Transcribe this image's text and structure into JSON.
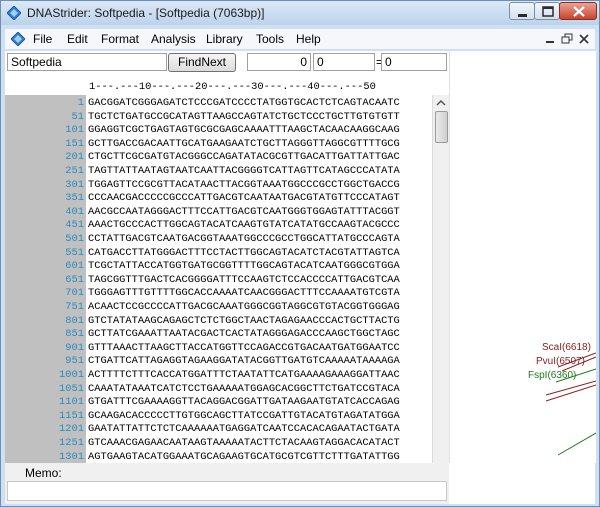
{
  "window": {
    "title": "DNAStrider: Softpedia - [Softpedia (7063bp)]"
  },
  "menu": [
    "File",
    "Edit",
    "Format",
    "Analysis",
    "Library",
    "Tools",
    "Help"
  ],
  "toolbar": {
    "search_value": "Softpedia",
    "findnext_label": "FindNext",
    "range_start": "0",
    "range_sep": "-",
    "range_end": "0",
    "equals": "=",
    "range_result": "0"
  },
  "ruler": "1---.---10---.---20---.---30---.---40---.---50",
  "sequence": [
    {
      "n": "1",
      "s": "GACGGATCGGGAGATCTCCCGATCCCCTATGGTGCACTCTCAGTACAATC"
    },
    {
      "n": "51",
      "s": "TGCTCTGATGCCGCATAGTTAAGCCAGTATCTGCTCCCTGCTTGTGTGTT"
    },
    {
      "n": "101",
      "s": "GGAGGTCGCTGAGTAGTGCGCGAGCAAAATTTAAGCTACAACAAGGCAAG"
    },
    {
      "n": "151",
      "s": "GCTTGACCGACAATTGCATGAAGAATCTGCTTAGGGTTAGGCGTTTTGCG"
    },
    {
      "n": "201",
      "s": "CTGCTTCGCGATGTACGGGCCAGATATACGCGTTGACATTGATTATTGAC"
    },
    {
      "n": "251",
      "s": "TAGTTATTAATAGTAATCAATTACGGGGTCATTAGTTCATAGCCCATATA"
    },
    {
      "n": "301",
      "s": "TGGAGTTCCGCGTTACATAACTTACGGTAAATGGCCCGCCTGGCTGACCG"
    },
    {
      "n": "351",
      "s": "CCCAACGACCCCCGCCCATTGACGTCAATAATGACGTATGTTCCCATAGT"
    },
    {
      "n": "401",
      "s": "AACGCCAATAGGGACTTTCCATTGACGTCAATGGGTGGAGTATTTACGGT"
    },
    {
      "n": "451",
      "s": "AAACTGCCCACTTGGCAGTACATCAAGTGTATCATATGCCAAGTACGCCC"
    },
    {
      "n": "501",
      "s": "CCTATTGACGTCAATGACGGTAAATGGCCCGCCTGGCATTATGCCCAGTA"
    },
    {
      "n": "551",
      "s": "CATGACCTTATGGGACTTTCCTACTTGGCAGTACATCTACGTATTAGTCA"
    },
    {
      "n": "601",
      "s": "TCGCTATTACCATGGTGATGCGGTTTTGGCAGTACATCAATGGGCGTGGA"
    },
    {
      "n": "651",
      "s": "TAGCGGTTTGACTCACGGGGATTTCCAAGTCTCCACCCCATTGACGTCAA"
    },
    {
      "n": "701",
      "s": "TGGGAGTTTGTTTTGGCACCAAAATCAACGGGACTTTCCAAAATGTCGTA"
    },
    {
      "n": "751",
      "s": "ACAACTCCGCCCCATTGACGCAAATGGGCGGTAGGCGTGTACGGTGGGAG"
    },
    {
      "n": "801",
      "s": "GTCTATATAAGCAGAGCTCTCTGGCTAACTAGAGAACCCACTGCTTACTG"
    },
    {
      "n": "851",
      "s": "GCTTATCGAAATTAATACGACTCACTATAGGGAGACCCAAGCTGGCTAGC"
    },
    {
      "n": "901",
      "s": "GTTTAAACTTAAGCTTACCATGGTTCCAGACCGTGACAATGATGGAATCC"
    },
    {
      "n": "951",
      "s": "CTGATTCATTAGAGGTAGAAGGATATACGGTTGATGTCAAAAATAAAAGA"
    },
    {
      "n": "1001",
      "s": "ACTTTTCTTTCACCATGGATTTCTAATATTCATGAAAAGAAAGGATTAAC"
    },
    {
      "n": "1051",
      "s": "CAAATATAAATCATCTCCTGAAAAATGGAGCACGGCTTCTGATCCGTACA"
    },
    {
      "n": "1101",
      "s": "GTGATTTCGAAAAGGTTACAGGACGGATTGATAAGAATGTATCACCAGAG"
    },
    {
      "n": "1151",
      "s": "GCAAGACACCCCCTTGTGGCAGCTTATCCGATTGTACATGTAGATATGGA"
    },
    {
      "n": "1201",
      "s": "GAATATTATTCTCTCAAAAAATGAGGATCAATCCACACAGAATACTGATA"
    },
    {
      "n": "1251",
      "s": "GTCAAACGAGAACAATAAGTAAAAATACTTCTACAAGTAGGACACATACT"
    },
    {
      "n": "1301",
      "s": "AGTGAAGTACATGGAAATGCAGAAGTGCATGCGTCGTTCTTTGATATTGG"
    }
  ],
  "enzymes": [
    {
      "label": "ScaI(6618)",
      "color": "#8b2020"
    },
    {
      "label": "PvuI(6507)",
      "color": "#8b2020"
    },
    {
      "label": "FspI(6360)",
      "color": "#1e7a1e"
    }
  ],
  "memo": {
    "label": "Memo:"
  }
}
